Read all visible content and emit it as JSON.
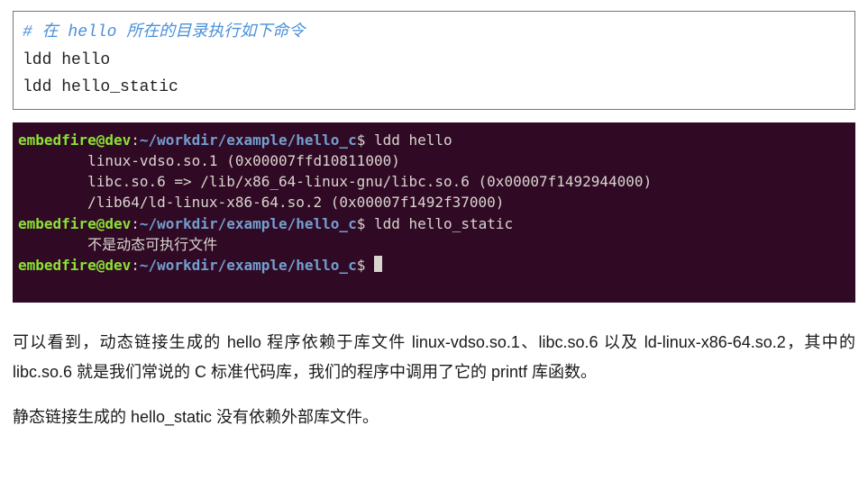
{
  "codebox": {
    "comment": "# 在 hello 所在的目录执行如下命令",
    "cmd1": "ldd hello",
    "cmd2": "ldd hello_static"
  },
  "term": {
    "prompt_user": "embedfire@dev",
    "prompt_colon": ":",
    "prompt_path": "~/workdir/example/hello_c",
    "prompt_dollar": "$",
    "cmd1": "ldd hello",
    "out1": "        linux-vdso.so.1 (0x00007ffd10811000)",
    "out2": "        libc.so.6 => /lib/x86_64-linux-gnu/libc.so.6 (0x00007f1492944000)",
    "out3": "        /lib64/ld-linux-x86-64.so.2 (0x00007f1492f37000)",
    "cmd2": "ldd hello_static",
    "out4": "        不是动态可执行文件"
  },
  "para1": "可以看到，动态链接生成的 hello 程序依赖于库文件 linux-vdso.so.1、libc.so.6 以及 ld-linux-x86-64.so.2，其中的 libc.so.6 就是我们常说的 C 标准代码库，我们的程序中调用了它的 printf 库函数。",
  "para2": "静态链接生成的 hello_static 没有依赖外部库文件。"
}
